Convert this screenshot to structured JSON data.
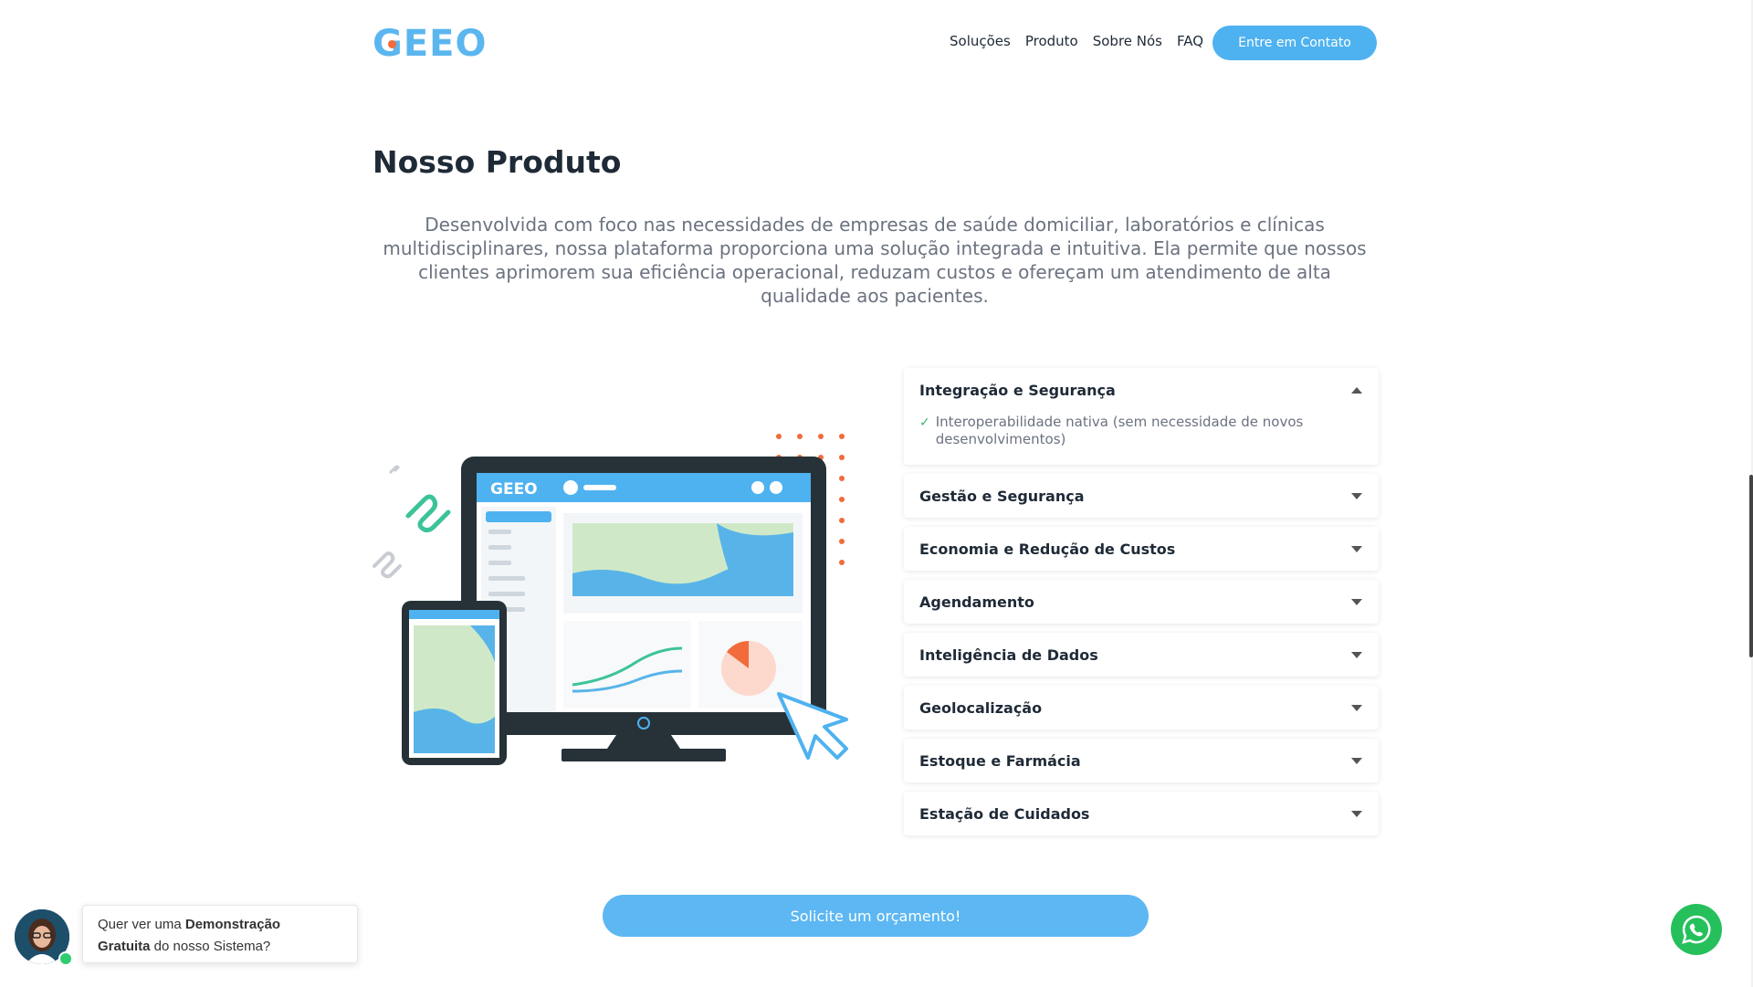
{
  "header": {
    "logo_text": "GEEO",
    "nav": [
      "Soluções",
      "Produto",
      "Sobre Nós",
      "FAQ"
    ],
    "contact_button": "Entre em Contato"
  },
  "main": {
    "title": "Nosso Produto",
    "intro": "Desenvolvida com foco nas necessidades de empresas de saúde domiciliar, laboratórios e clínicas multidisciplinares, nossa plataforma proporciona uma solução integrada e intuitiva. Ela permite que nossos clientes aprimorem sua eficiência operacional, reduzam custos e ofereçam um atendimento de alta qualidade aos pacientes.",
    "illustration_logo": "GEEO"
  },
  "accordion": {
    "items": [
      {
        "label": "Integração e Segurança",
        "expanded": true,
        "body": "Interoperabilidade nativa (sem necessidade de novos desenvolvimentos)"
      },
      {
        "label": "Gestão e Segurança",
        "expanded": false
      },
      {
        "label": "Economia e Redução de Custos",
        "expanded": false
      },
      {
        "label": "Agendamento",
        "expanded": false
      },
      {
        "label": "Inteligência de Dados",
        "expanded": false
      },
      {
        "label": "Geolocalização",
        "expanded": false
      },
      {
        "label": "Estoque e Farmácia",
        "expanded": false
      },
      {
        "label": "Estação de Cuidados",
        "expanded": false
      }
    ]
  },
  "cta": {
    "quote_button": "Solicite um orçamento!"
  },
  "chat": {
    "prefix": "Quer ver uma ",
    "bold1": "Demonstração",
    "bold2": "Gratuita",
    "suffix": " do nosso Sistema?"
  },
  "colors": {
    "brand_blue": "#5bb6ef",
    "accent_orange": "#f26b3a",
    "whatsapp_green": "#25c05c"
  }
}
